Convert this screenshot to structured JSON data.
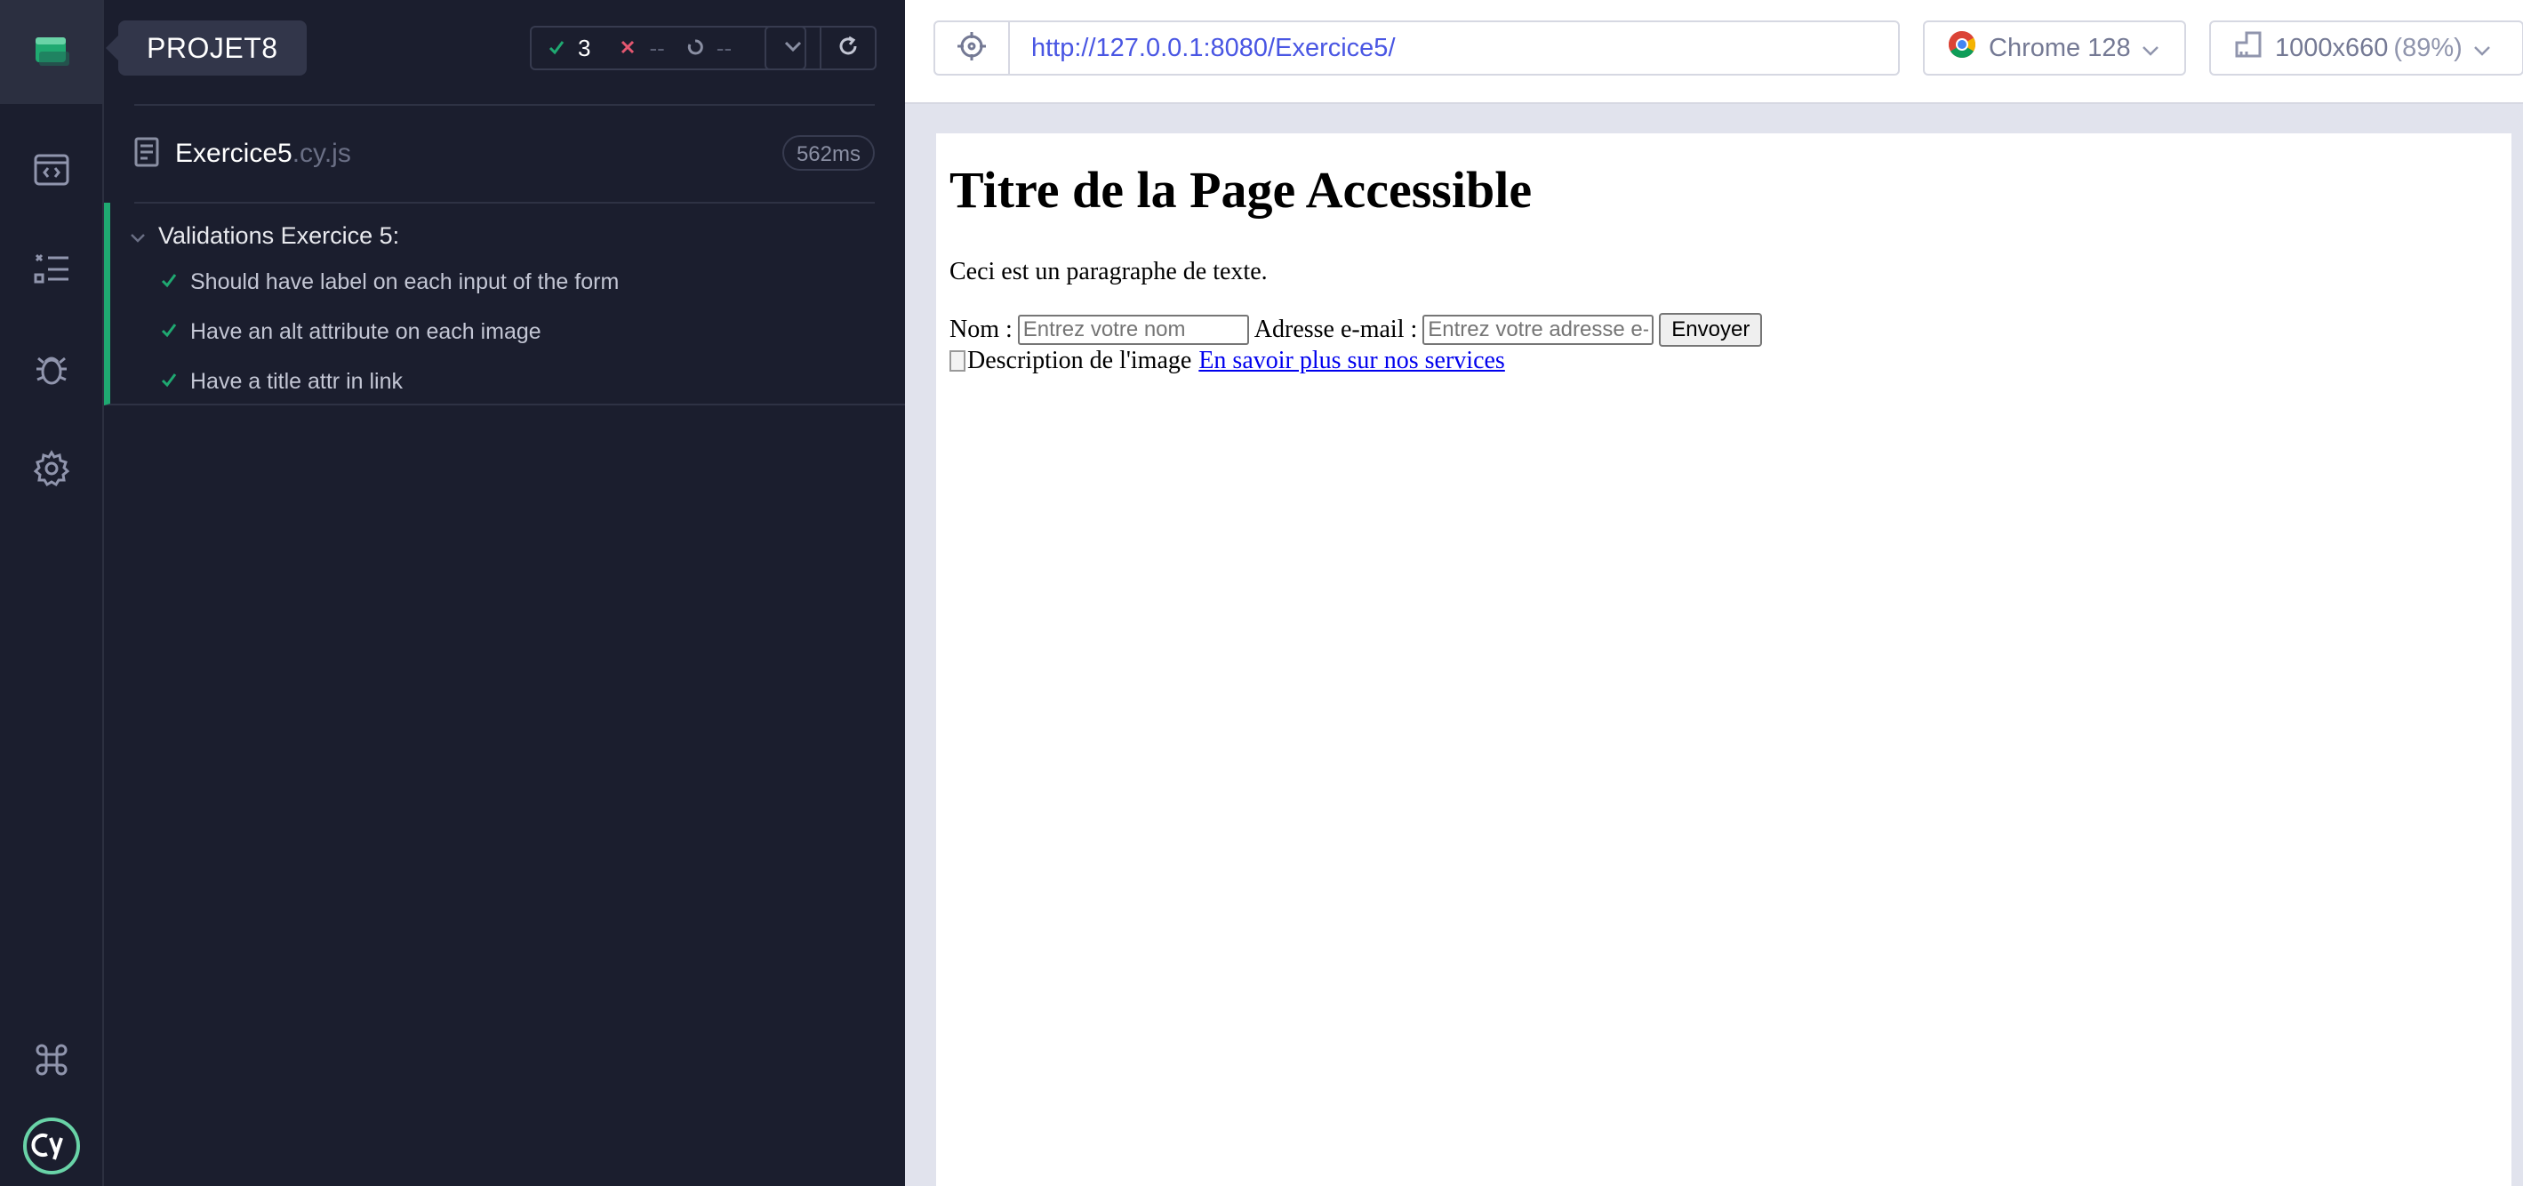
{
  "project": {
    "name": "PROJET8"
  },
  "stats": {
    "passed": "3",
    "failed": "--",
    "pending": "--"
  },
  "spec": {
    "name": "Exercice5",
    "ext": ".cy.js",
    "duration": "562ms"
  },
  "suite": {
    "title": "Validations Exercice 5:",
    "tests": [
      {
        "label": "Should have label on each input of the form",
        "status": "passed"
      },
      {
        "label": "Have an alt attribute on each image",
        "status": "passed"
      },
      {
        "label": "Have a title attr in link",
        "status": "passed"
      }
    ]
  },
  "browser_bar": {
    "url": "http://127.0.0.1:8080/Exercice5/",
    "browser": "Chrome 128",
    "viewport": "1000x660",
    "zoom": "(89%)"
  },
  "aut": {
    "heading": "Titre de la Page Accessible",
    "paragraph": "Ceci est un paragraphe de texte.",
    "name_label": "Nom :",
    "name_placeholder": "Entrez votre nom",
    "email_label": "Adresse e-mail :",
    "email_placeholder": "Entrez votre adresse e-",
    "submit_label": "Envoyer",
    "image_alt": "Description de l'image",
    "link_text": "En savoir plus sur nos services"
  },
  "colors": {
    "pass": "#1fa971",
    "fail": "#e45770",
    "url": "#4956e3",
    "nav_bg": "#1b1e2e"
  }
}
